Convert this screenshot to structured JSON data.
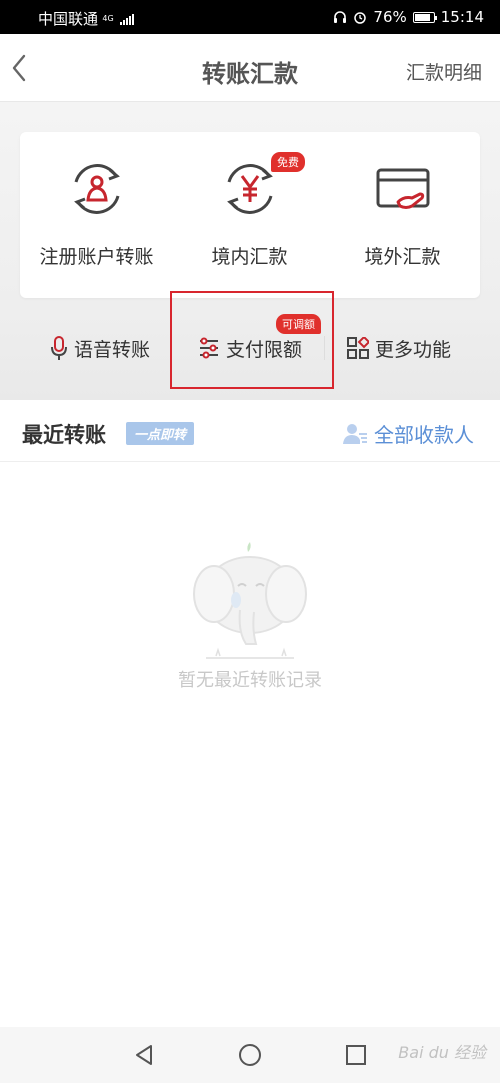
{
  "status_bar": {
    "carrier": "中国联通",
    "network": "4G",
    "battery": "76%",
    "battery_level": 0.76,
    "time": "15:14"
  },
  "navbar": {
    "title": "转账汇款",
    "right_link": "汇款明细"
  },
  "services": [
    {
      "label": "注册账户转账",
      "icon": "register-transfer-icon"
    },
    {
      "label": "境内汇款",
      "icon": "domestic-remit-icon",
      "badge": "免费"
    },
    {
      "label": "境外汇款",
      "icon": "overseas-remit-icon"
    }
  ],
  "quick": {
    "voice": "语音转账",
    "limit": "支付限额",
    "limit_badge": "可调额",
    "more": "更多功能"
  },
  "recent": {
    "title": "最近转账",
    "tag": "一点即转",
    "all_payees": "全部收款人",
    "empty_text": "暂无最近转账记录"
  },
  "watermark": "Bai du 经验",
  "colors": {
    "accent_red": "#d8262e",
    "link_blue": "#5b8fd6",
    "badge_red": "#e0302c"
  }
}
